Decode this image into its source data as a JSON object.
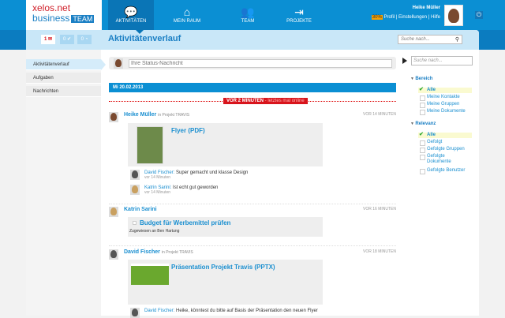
{
  "logo": {
    "line1": "xelos.net",
    "line2": "business",
    "badge": "TEAM"
  },
  "nav": [
    {
      "label": "AKTIVITÄTEN",
      "icon": "speech-bubbles-icon",
      "active": true
    },
    {
      "label": "MEIN RAUM",
      "icon": "home-icon"
    },
    {
      "label": "TEAM",
      "icon": "people-icon"
    },
    {
      "label": "PROJEKTE",
      "icon": "enter-icon"
    }
  ],
  "user": {
    "name": "Heike Müller",
    "progress": "30%",
    "links": [
      "Profil",
      "Einstellungen",
      "Hilfe"
    ]
  },
  "counters": [
    {
      "value": "1",
      "icon": "mail-icon",
      "color": "#d8141c"
    },
    {
      "value": "0",
      "icon": "check-icon"
    },
    {
      "value": "0",
      "icon": "rss-icon"
    }
  ],
  "page_title": "Aktivitätenverlauf",
  "search_placeholder": "Suche nach...",
  "sidebar": [
    "Aktivitätenverlauf",
    "Aufgaben",
    "Nachrichten"
  ],
  "status_placeholder": "Ihre Status-Nachricht",
  "date": "Mi 20.02.2013",
  "online": {
    "strong": "VOR 2 MINUTEN",
    "rest": " - letztes mal online"
  },
  "posts": [
    {
      "name": "Heike Müller",
      "project": "in Projekt TRAVIS",
      "time": "VOR 14 MINUTEN",
      "title": "Flyer (PDF)",
      "comments": [
        {
          "name": "David Fischer:",
          "text": " Super gemacht und klasse Design",
          "time": "vor 14 Minuten"
        },
        {
          "name": "Katrin Sarini:",
          "text": " Ist echt gut geworden",
          "time": "vor 14 Minuten"
        }
      ]
    },
    {
      "name": "Katrin Sarini",
      "time": "VOR 16 MINUTEN",
      "title": "Budget für Werbemittel prüfen",
      "assigned": "Zugewiesen an Ben Hartung"
    },
    {
      "name": "David Fischer",
      "project": "in Projekt TRAVIS",
      "time": "VOR 18 MINUTEN",
      "title": "Präsentation Projekt Travis (PPTX)",
      "comments": [
        {
          "name": "David Fischer:",
          "text": " Heike, könntest du bitte auf Basis der Präsentation den neuen Flyer"
        }
      ]
    }
  ],
  "filter": {
    "search_placeholder": "Suche nach...",
    "groups": [
      {
        "title": "Bereich",
        "items": [
          "Alle",
          "Meine Kontakte",
          "Meine Gruppen",
          "Meine Dokumente"
        ]
      },
      {
        "title": "Relevanz",
        "items": [
          "Alle",
          "Gefolgt",
          "Gefolgte Gruppen",
          "Gefolgte Dokumente",
          "Gefolgte Benutzer"
        ]
      }
    ]
  }
}
